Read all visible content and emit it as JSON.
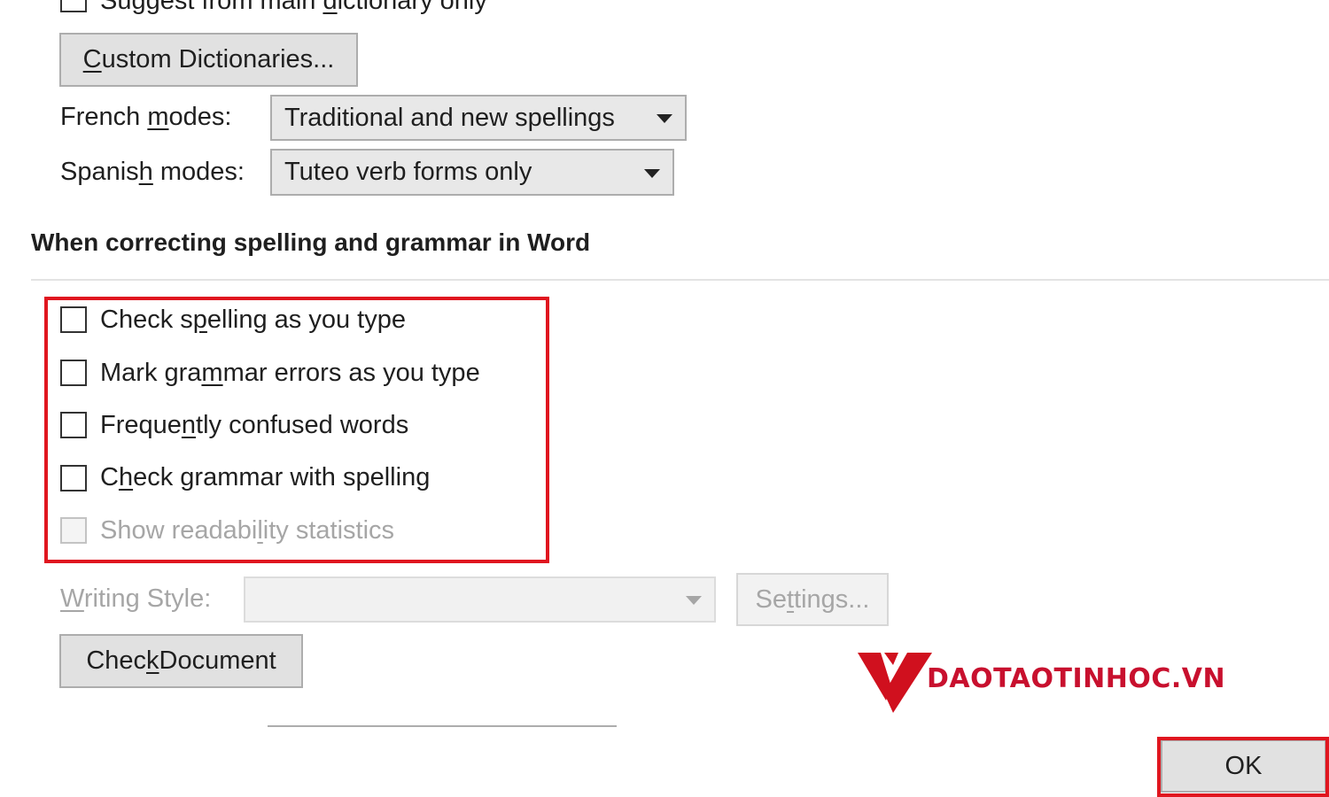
{
  "top_option": {
    "prefix": "Suggest from main ",
    "underline": "d",
    "suffix": "ictionary only",
    "checked": false
  },
  "custom_dictionaries_button": {
    "underline": "C",
    "rest": "ustom Dictionaries..."
  },
  "french_modes": {
    "label_prefix": "French ",
    "label_underline": "m",
    "label_suffix": "odes:",
    "value": "Traditional and new spellings"
  },
  "spanish_modes": {
    "label_prefix": "Spanis",
    "label_underline": "h",
    "label_suffix": " modes:",
    "value": "Tuteo verb forms only"
  },
  "section": {
    "heading": "When correcting spelling and grammar in Word"
  },
  "options": [
    {
      "prefix": "Check s",
      "underline": "p",
      "suffix": "elling as you type",
      "checked": false,
      "disabled": false
    },
    {
      "prefix": "Mark gra",
      "underline": "m",
      "suffix": "mar errors as you type",
      "checked": false,
      "disabled": false
    },
    {
      "prefix": "Freque",
      "underline": "n",
      "suffix": "tly confused words",
      "checked": false,
      "disabled": false
    },
    {
      "prefix": "C",
      "underline": "h",
      "suffix": "eck grammar with spelling",
      "checked": false,
      "disabled": false
    },
    {
      "prefix": "Show readabi",
      "underline": "l",
      "suffix": "ity statistics",
      "checked": false,
      "disabled": true
    }
  ],
  "writing_style": {
    "label_underline": "W",
    "label_rest": "riting Style:",
    "value": "",
    "disabled": true
  },
  "settings_button": {
    "prefix": "Se",
    "underline": "t",
    "suffix": "tings...",
    "disabled": true
  },
  "check_document_button": {
    "prefix": "Chec",
    "underline": "k",
    "suffix": " Document"
  },
  "watermark": {
    "text": "DAOTAOTINHOC.VN",
    "color": "#c8102e"
  },
  "ok_button": {
    "label": "OK"
  },
  "colors": {
    "highlight": "#e0161f",
    "disabled_text": "#a6a6a6",
    "button_bg": "#e1e1e1"
  }
}
